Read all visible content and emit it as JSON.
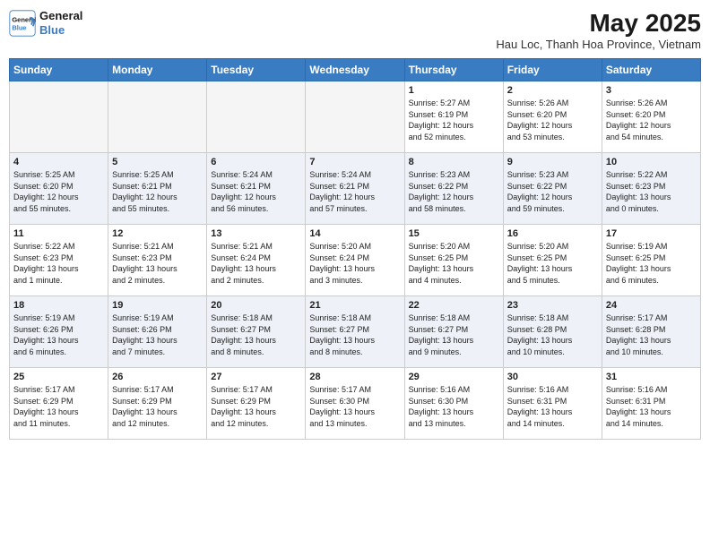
{
  "header": {
    "logo_line1": "General",
    "logo_line2": "Blue",
    "month_year": "May 2025",
    "location": "Hau Loc, Thanh Hoa Province, Vietnam"
  },
  "days_of_week": [
    "Sunday",
    "Monday",
    "Tuesday",
    "Wednesday",
    "Thursday",
    "Friday",
    "Saturday"
  ],
  "weeks": [
    [
      {
        "day": "",
        "info": ""
      },
      {
        "day": "",
        "info": ""
      },
      {
        "day": "",
        "info": ""
      },
      {
        "day": "",
        "info": ""
      },
      {
        "day": "1",
        "info": "Sunrise: 5:27 AM\nSunset: 6:19 PM\nDaylight: 12 hours\nand 52 minutes."
      },
      {
        "day": "2",
        "info": "Sunrise: 5:26 AM\nSunset: 6:20 PM\nDaylight: 12 hours\nand 53 minutes."
      },
      {
        "day": "3",
        "info": "Sunrise: 5:26 AM\nSunset: 6:20 PM\nDaylight: 12 hours\nand 54 minutes."
      }
    ],
    [
      {
        "day": "4",
        "info": "Sunrise: 5:25 AM\nSunset: 6:20 PM\nDaylight: 12 hours\nand 55 minutes."
      },
      {
        "day": "5",
        "info": "Sunrise: 5:25 AM\nSunset: 6:21 PM\nDaylight: 12 hours\nand 55 minutes."
      },
      {
        "day": "6",
        "info": "Sunrise: 5:24 AM\nSunset: 6:21 PM\nDaylight: 12 hours\nand 56 minutes."
      },
      {
        "day": "7",
        "info": "Sunrise: 5:24 AM\nSunset: 6:21 PM\nDaylight: 12 hours\nand 57 minutes."
      },
      {
        "day": "8",
        "info": "Sunrise: 5:23 AM\nSunset: 6:22 PM\nDaylight: 12 hours\nand 58 minutes."
      },
      {
        "day": "9",
        "info": "Sunrise: 5:23 AM\nSunset: 6:22 PM\nDaylight: 12 hours\nand 59 minutes."
      },
      {
        "day": "10",
        "info": "Sunrise: 5:22 AM\nSunset: 6:23 PM\nDaylight: 13 hours\nand 0 minutes."
      }
    ],
    [
      {
        "day": "11",
        "info": "Sunrise: 5:22 AM\nSunset: 6:23 PM\nDaylight: 13 hours\nand 1 minute."
      },
      {
        "day": "12",
        "info": "Sunrise: 5:21 AM\nSunset: 6:23 PM\nDaylight: 13 hours\nand 2 minutes."
      },
      {
        "day": "13",
        "info": "Sunrise: 5:21 AM\nSunset: 6:24 PM\nDaylight: 13 hours\nand 2 minutes."
      },
      {
        "day": "14",
        "info": "Sunrise: 5:20 AM\nSunset: 6:24 PM\nDaylight: 13 hours\nand 3 minutes."
      },
      {
        "day": "15",
        "info": "Sunrise: 5:20 AM\nSunset: 6:25 PM\nDaylight: 13 hours\nand 4 minutes."
      },
      {
        "day": "16",
        "info": "Sunrise: 5:20 AM\nSunset: 6:25 PM\nDaylight: 13 hours\nand 5 minutes."
      },
      {
        "day": "17",
        "info": "Sunrise: 5:19 AM\nSunset: 6:25 PM\nDaylight: 13 hours\nand 6 minutes."
      }
    ],
    [
      {
        "day": "18",
        "info": "Sunrise: 5:19 AM\nSunset: 6:26 PM\nDaylight: 13 hours\nand 6 minutes."
      },
      {
        "day": "19",
        "info": "Sunrise: 5:19 AM\nSunset: 6:26 PM\nDaylight: 13 hours\nand 7 minutes."
      },
      {
        "day": "20",
        "info": "Sunrise: 5:18 AM\nSunset: 6:27 PM\nDaylight: 13 hours\nand 8 minutes."
      },
      {
        "day": "21",
        "info": "Sunrise: 5:18 AM\nSunset: 6:27 PM\nDaylight: 13 hours\nand 8 minutes."
      },
      {
        "day": "22",
        "info": "Sunrise: 5:18 AM\nSunset: 6:27 PM\nDaylight: 13 hours\nand 9 minutes."
      },
      {
        "day": "23",
        "info": "Sunrise: 5:18 AM\nSunset: 6:28 PM\nDaylight: 13 hours\nand 10 minutes."
      },
      {
        "day": "24",
        "info": "Sunrise: 5:17 AM\nSunset: 6:28 PM\nDaylight: 13 hours\nand 10 minutes."
      }
    ],
    [
      {
        "day": "25",
        "info": "Sunrise: 5:17 AM\nSunset: 6:29 PM\nDaylight: 13 hours\nand 11 minutes."
      },
      {
        "day": "26",
        "info": "Sunrise: 5:17 AM\nSunset: 6:29 PM\nDaylight: 13 hours\nand 12 minutes."
      },
      {
        "day": "27",
        "info": "Sunrise: 5:17 AM\nSunset: 6:29 PM\nDaylight: 13 hours\nand 12 minutes."
      },
      {
        "day": "28",
        "info": "Sunrise: 5:17 AM\nSunset: 6:30 PM\nDaylight: 13 hours\nand 13 minutes."
      },
      {
        "day": "29",
        "info": "Sunrise: 5:16 AM\nSunset: 6:30 PM\nDaylight: 13 hours\nand 13 minutes."
      },
      {
        "day": "30",
        "info": "Sunrise: 5:16 AM\nSunset: 6:31 PM\nDaylight: 13 hours\nand 14 minutes."
      },
      {
        "day": "31",
        "info": "Sunrise: 5:16 AM\nSunset: 6:31 PM\nDaylight: 13 hours\nand 14 minutes."
      }
    ]
  ]
}
